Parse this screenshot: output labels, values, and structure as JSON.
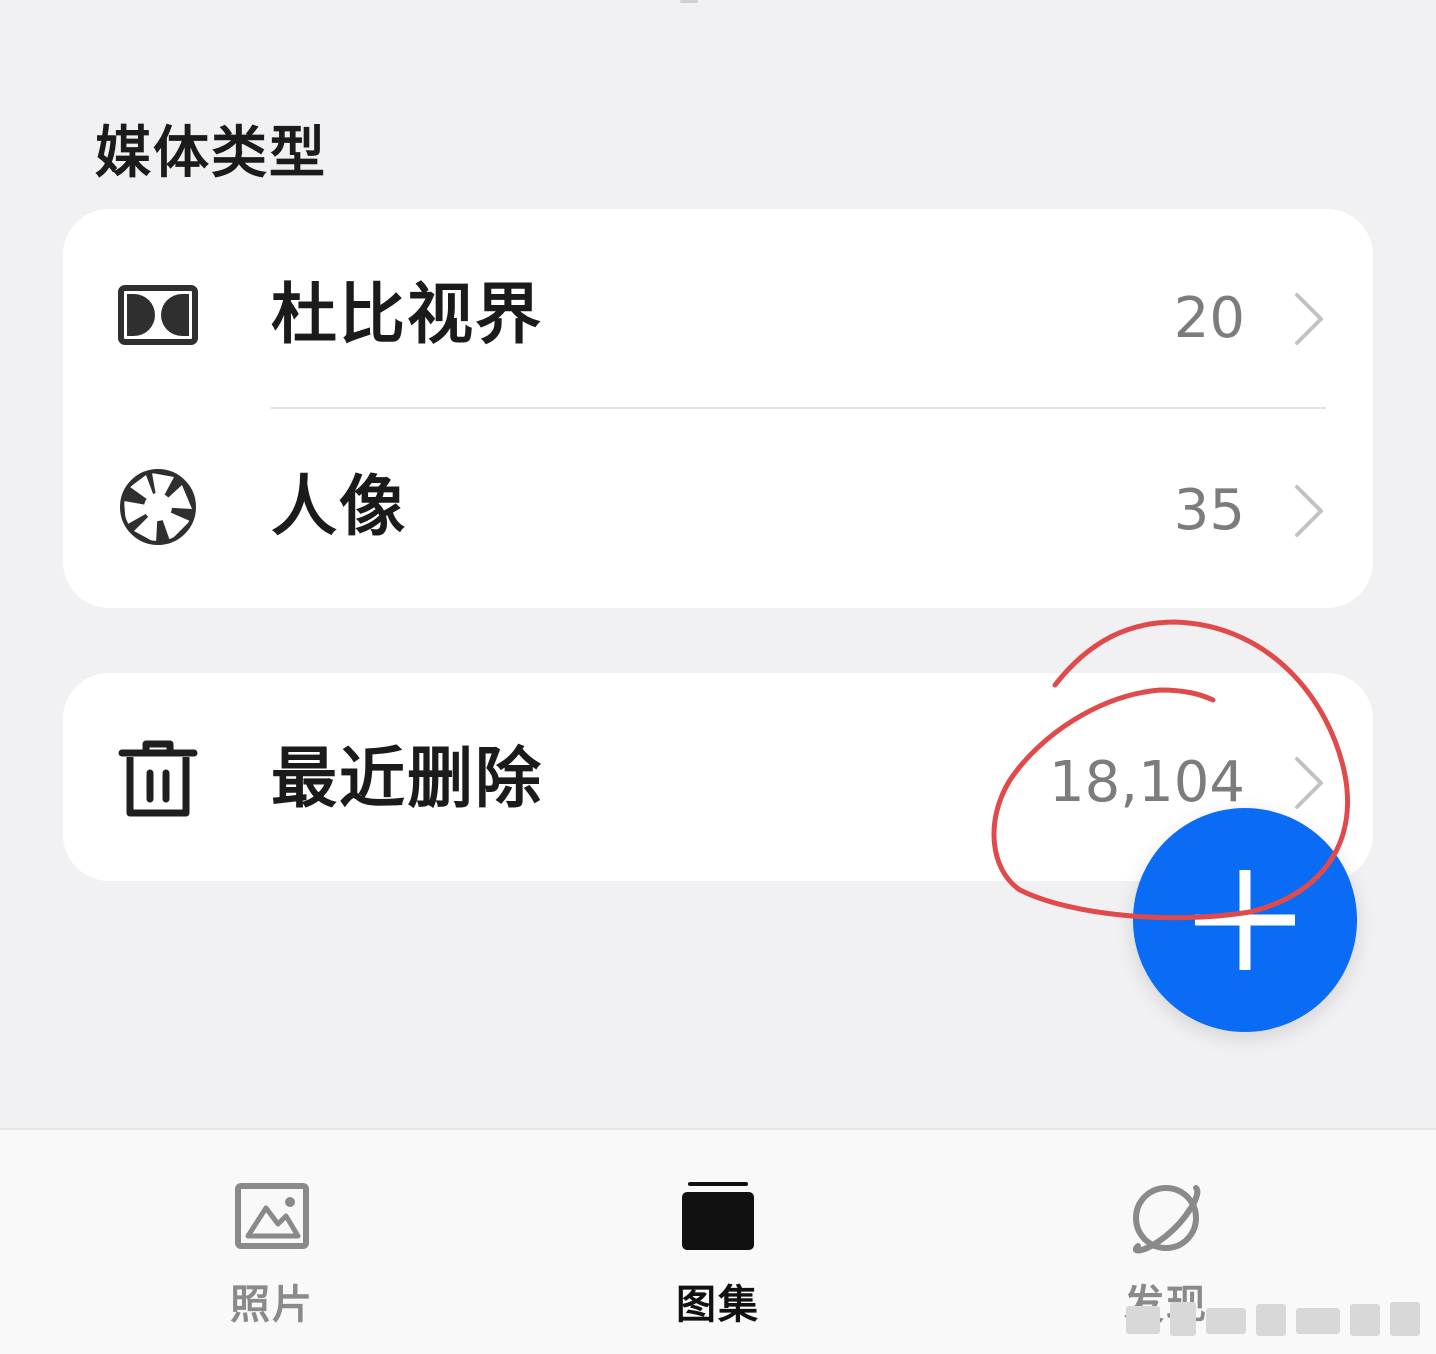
{
  "section": {
    "title": "媒体类型"
  },
  "media_types": [
    {
      "label": "杜比视界",
      "count": "20",
      "icon": "dolby-vision-icon"
    },
    {
      "label": "人像",
      "count": "35",
      "icon": "aperture-icon"
    }
  ],
  "trash": {
    "label": "最近删除",
    "count": "18,104",
    "icon": "trash-icon"
  },
  "fab": {
    "icon": "plus-icon",
    "color": "#0a6cf5"
  },
  "annotation": {
    "color": "#e04a4a"
  },
  "nav": {
    "items": [
      {
        "label": "照片",
        "icon": "photo-icon",
        "active": false
      },
      {
        "label": "图集",
        "icon": "album-icon",
        "active": true
      },
      {
        "label": "发现",
        "icon": "planet-icon",
        "active": false
      }
    ]
  }
}
